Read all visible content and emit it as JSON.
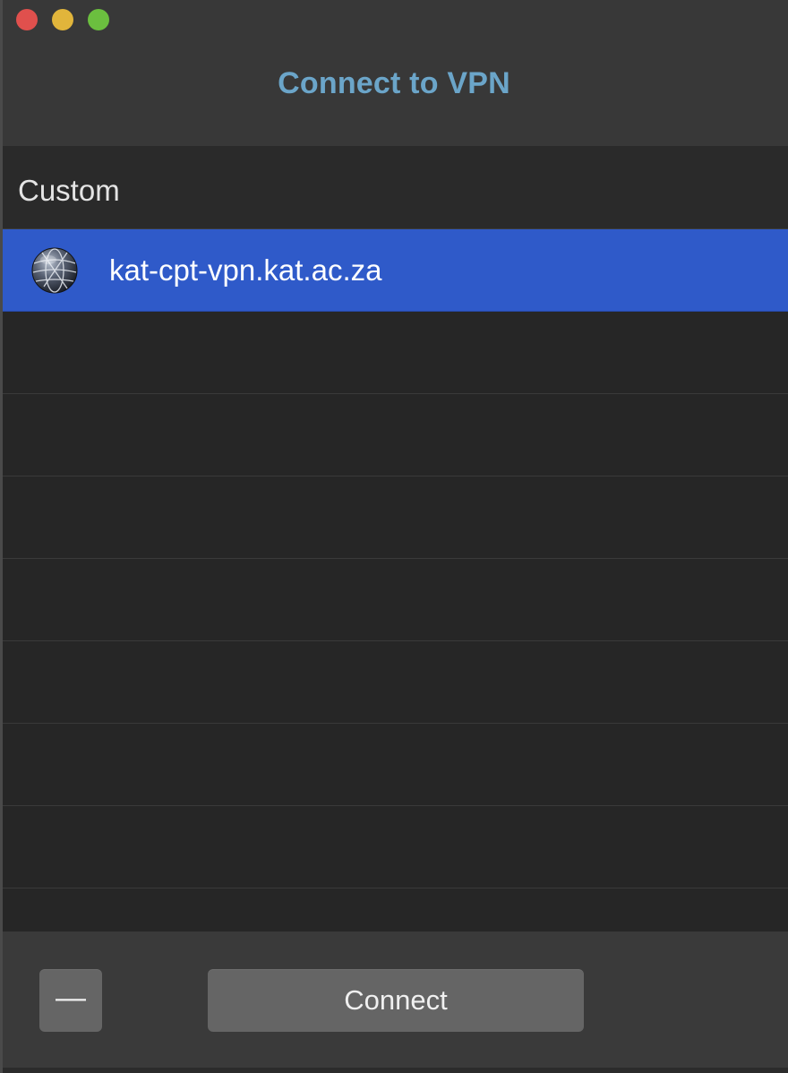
{
  "window": {
    "title": "Connect to VPN",
    "title_color": "#6ba5c9"
  },
  "list": {
    "section_header": "Custom",
    "items": [
      {
        "label": "kat-cpt-vpn.kat.ac.za",
        "icon": "network-globe-icon",
        "selected": true
      }
    ],
    "selection_color": "#2f5ac9"
  },
  "footer": {
    "remove_label": "—",
    "connect_label": "Connect"
  }
}
